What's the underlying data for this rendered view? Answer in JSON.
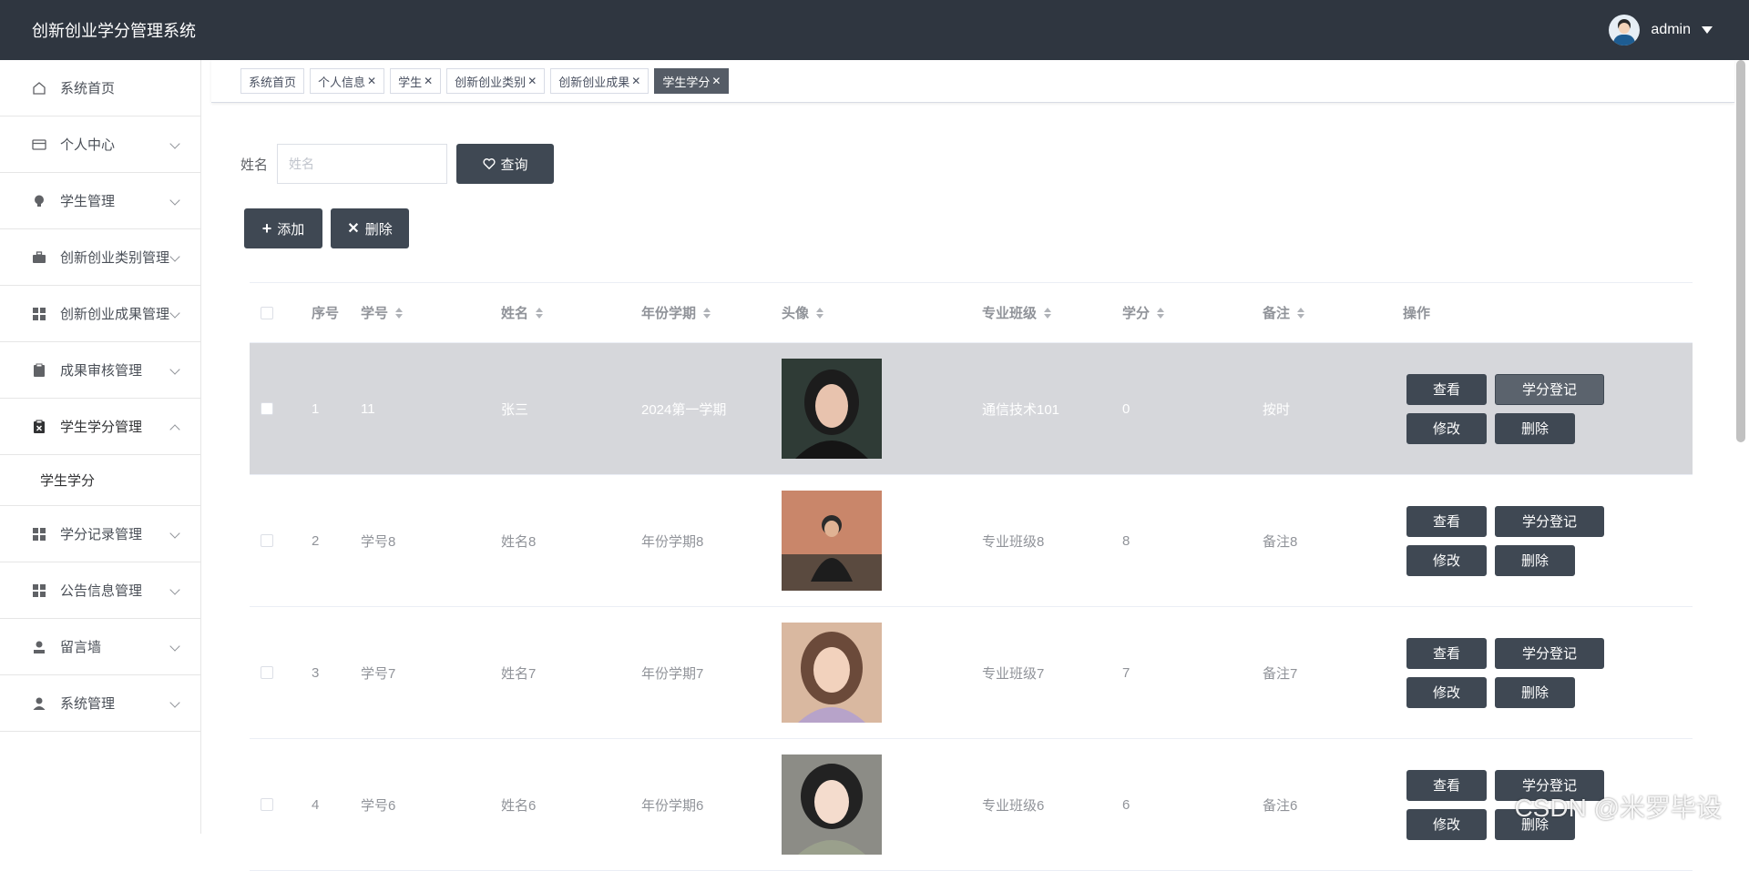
{
  "header": {
    "title": "创新创业学分管理系统",
    "username": "admin"
  },
  "sidebar": {
    "items": [
      {
        "label": "系统首页",
        "icon": "home-icon"
      },
      {
        "label": "个人中心",
        "icon": "card-icon"
      },
      {
        "label": "学生管理",
        "icon": "bulb-icon"
      },
      {
        "label": "创新创业类别管理",
        "icon": "briefcase-icon"
      },
      {
        "label": "创新创业成果管理",
        "icon": "grid-icon"
      },
      {
        "label": "成果审核管理",
        "icon": "clipboard-icon"
      },
      {
        "label": "学生学分管理",
        "icon": "clipboard-x-icon"
      },
      {
        "label": "学分记录管理",
        "icon": "grid-icon"
      },
      {
        "label": "公告信息管理",
        "icon": "grid-icon"
      },
      {
        "label": "留言墙",
        "icon": "user-icon"
      },
      {
        "label": "系统管理",
        "icon": "user-icon"
      }
    ],
    "subitem": "学生学分"
  },
  "tabs": [
    {
      "label": "系统首页",
      "closable": false
    },
    {
      "label": "个人信息",
      "closable": true
    },
    {
      "label": "学生",
      "closable": true
    },
    {
      "label": "创新创业类别",
      "closable": true
    },
    {
      "label": "创新创业成果",
      "closable": true
    },
    {
      "label": "学生学分",
      "closable": true,
      "active": true
    }
  ],
  "search": {
    "label": "姓名",
    "placeholder": "姓名",
    "button": "查询"
  },
  "actions": {
    "add": "添加",
    "delete": "删除"
  },
  "table": {
    "headers": {
      "index": "序号",
      "student_no": "学号",
      "name": "姓名",
      "term": "年份学期",
      "photo": "头像",
      "class": "专业班级",
      "credit": "学分",
      "remark": "备注",
      "ops": "操作"
    },
    "rows": [
      {
        "index": "1",
        "student_no": "11",
        "name": "张三",
        "term": "2024第一学期",
        "class": "通信技术101",
        "credit": "0",
        "remark": "按时"
      },
      {
        "index": "2",
        "student_no": "学号8",
        "name": "姓名8",
        "term": "年份学期8",
        "class": "专业班级8",
        "credit": "8",
        "remark": "备注8"
      },
      {
        "index": "3",
        "student_no": "学号7",
        "name": "姓名7",
        "term": "年份学期7",
        "class": "专业班级7",
        "credit": "7",
        "remark": "备注7"
      },
      {
        "index": "4",
        "student_no": "学号6",
        "name": "姓名6",
        "term": "年份学期6",
        "class": "专业班级6",
        "credit": "6",
        "remark": "备注6"
      }
    ],
    "row_buttons": {
      "view": "查看",
      "credit": "学分登记",
      "edit": "修改",
      "delete": "删除"
    }
  },
  "watermark": "CSDN @米罗毕设",
  "colors": {
    "header_bg": "#2f3640",
    "button_dark": "#3f4853",
    "active_tab": "#555c66",
    "highlight_row": "#d6d7db"
  }
}
